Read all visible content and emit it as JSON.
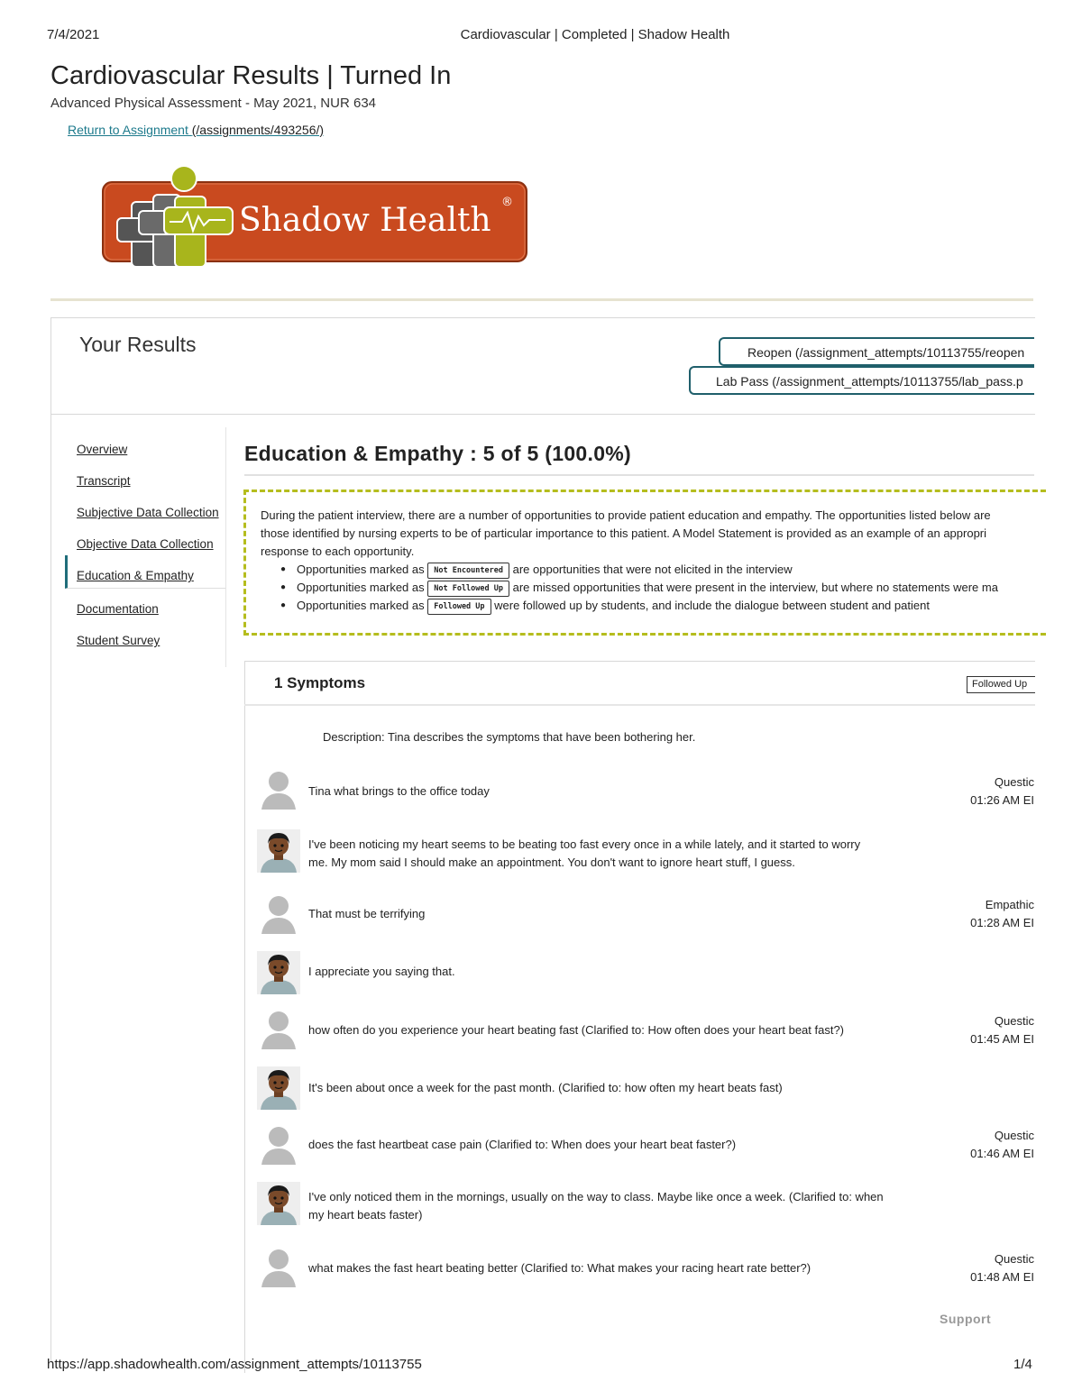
{
  "print_header": {
    "date": "7/4/2021",
    "title": "Cardiovascular | Completed | Shadow Health"
  },
  "print_footer": {
    "url": "https://app.shadowhealth.com/assignment_attempts/10113755",
    "page": "1/4"
  },
  "page": {
    "heading": "Cardiovascular Results | Turned In",
    "subtitle": "Advanced Physical Assessment - May 2021, NUR 634",
    "return_link": {
      "label": "Return to Assignment ",
      "path": "(/assignments/493256/)"
    }
  },
  "logo": {
    "text": "Shadow Health",
    "registered": "®",
    "colors": {
      "orange": "#c94a1f",
      "lime": "#a8b51c",
      "dark": "#3a3a3a"
    }
  },
  "results": {
    "title": "Your Results",
    "reopen_button": "Reopen (/assignment_attempts/10113755/reopen",
    "labpass_button": "Lab Pass (/assignment_attempts/10113755/lab_pass.p"
  },
  "sidebar": {
    "items": [
      {
        "label": "Overview"
      },
      {
        "label": "Transcript"
      },
      {
        "label": "Subjective Data Collection"
      },
      {
        "label": "Objective Data Collection"
      },
      {
        "label": "Education & Empathy",
        "active": true
      },
      {
        "label": "Documentation"
      },
      {
        "label": "Student Survey"
      }
    ]
  },
  "section": {
    "title": "Education & Empathy : 5 of 5 (100.0%)",
    "info": {
      "intro_1": "During the patient interview, there are a number of opportunities to provide patient education and empathy. The opportunities listed below are",
      "intro_2": "those identified by nursing experts to be of particular importance to this patient. A Model Statement is provided as an example of an appropri",
      "intro_3": "response to each opportunity.",
      "items": [
        {
          "prefix": "Opportunities marked as ",
          "badge": "Not Encountered",
          "suffix": " are opportunities that were not elicited in the interview"
        },
        {
          "prefix": "Opportunities marked as ",
          "badge": "Not Followed Up",
          "suffix": " are missed opportunities that were present in the interview, but where no statements were ma"
        },
        {
          "prefix": "Opportunities marked as ",
          "badge": "Followed Up",
          "suffix": " were followed up by students, and include the dialogue between student and patient"
        }
      ]
    }
  },
  "card": {
    "title": "1 Symptoms",
    "badge": "Followed Up",
    "description": "Description: Tina describes the symptoms that have been bothering her.",
    "conversation": [
      {
        "speaker": "student",
        "text": "Tina what brings to the office today",
        "type": "Questic",
        "time": "01:26 AM EI"
      },
      {
        "speaker": "patient",
        "text": "I've been noticing my heart seems to be beating too fast every once in a while lately, and it started to worry me. My mom said I should make an appointment. You don't want to ignore heart stuff, I guess."
      },
      {
        "speaker": "student",
        "text": "That must be terrifying",
        "type": "Empathic",
        "time": "01:28 AM EI"
      },
      {
        "speaker": "patient",
        "text": "I appreciate you saying that."
      },
      {
        "speaker": "student",
        "text": "how often do you experience your heart beating fast (Clarified to: How often does your heart beat fast?)",
        "type": "Questic",
        "time": "01:45 AM EI"
      },
      {
        "speaker": "patient",
        "text": "It's been about once a week for the past month. (Clarified to: how often my heart beats fast)"
      },
      {
        "speaker": "student",
        "text": "does the fast heartbeat case pain (Clarified to: When does your heart beat faster?)",
        "type": "Questic",
        "time": "01:46 AM EI"
      },
      {
        "speaker": "patient",
        "text": "I've only noticed them in the mornings, usually on the way to class. Maybe like once a week. (Clarified to: when my heart beats faster)"
      },
      {
        "speaker": "student",
        "text": "what makes the fast heart beating better (Clarified to: What makes your racing heart rate better?)",
        "type": "Questic",
        "time": "01:48 AM EI"
      }
    ]
  },
  "support_label": "Support"
}
